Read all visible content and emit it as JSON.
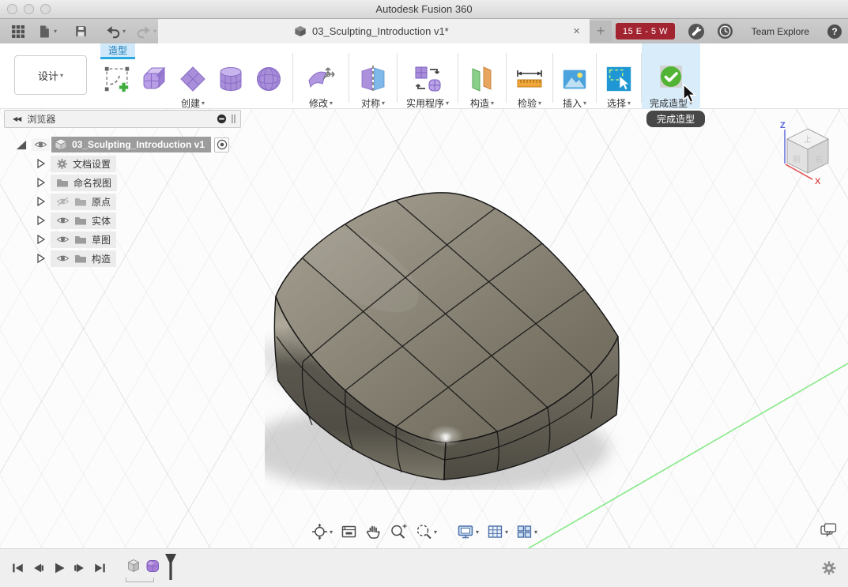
{
  "window": {
    "title": "Autodesk Fusion 360"
  },
  "appbar": {
    "doc_tab": {
      "title": "03_Sculpting_Introduction v1*"
    },
    "badge": "15 E - 5 W",
    "team_label": "Team Explore"
  },
  "glyphs": {
    "close": "×",
    "plus": "+",
    "help": "?",
    "collapse": "◀◀"
  },
  "ribbon": {
    "workspace_label": "设计",
    "active_tab": "造型",
    "groups": [
      {
        "label": "创建"
      },
      {
        "label": "修改"
      },
      {
        "label": "对称"
      },
      {
        "label": "实用程序"
      },
      {
        "label": "构造"
      },
      {
        "label": "检验"
      },
      {
        "label": "插入"
      },
      {
        "label": "选择"
      },
      {
        "label": "完成造型"
      }
    ],
    "tooltip": "完成造型"
  },
  "browser": {
    "panel_title": "浏览器",
    "root_label": "03_Sculpting_Introduction v1",
    "items": [
      {
        "label": "文档设置",
        "icon": "gear",
        "eye": "none"
      },
      {
        "label": "命名视图",
        "icon": "folder",
        "eye": "none"
      },
      {
        "label": "原点",
        "icon": "folder",
        "eye": "hidden"
      },
      {
        "label": "实体",
        "icon": "folder",
        "eye": "visible"
      },
      {
        "label": "草图",
        "icon": "folder",
        "eye": "visible"
      },
      {
        "label": "构造",
        "icon": "folder",
        "eye": "visible"
      }
    ]
  },
  "viewcube": {
    "axis_z": "Z",
    "axis_x": "X",
    "face_top": "上",
    "face_front": "前",
    "face_right": "右"
  },
  "colors": {
    "accent_blue": "#29a8e1",
    "badge_red": "#a32431",
    "finish_green": "#52b435",
    "axis_green": "#86e986",
    "primitive_purple": "#a98fd9",
    "model_gray": "#6e6a5f"
  }
}
